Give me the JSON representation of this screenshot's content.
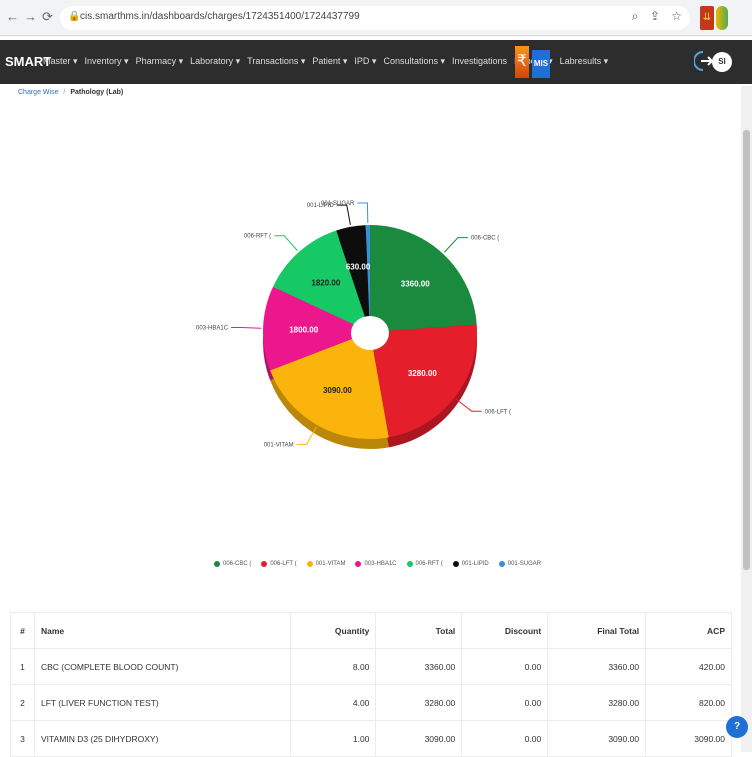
{
  "browser": {
    "url": "cis.smarthms.in/dashboards/charges/1724351400/1724437799",
    "back_icon": "arrow-left-icon",
    "forward_icon": "arrow-right-icon",
    "reload_icon": "reload-icon"
  },
  "nav": {
    "brand": "SMART",
    "menu": [
      "Master ▾",
      "Inventory ▾",
      "Pharmacy ▾",
      "Laboratory ▾",
      "Transactions ▾",
      "Patient ▾",
      "IPD ▾",
      "Consultations ▾",
      "Investigations",
      "Reports ▾",
      "Labresults ▾"
    ],
    "mis": "MIS",
    "avatar": "SI"
  },
  "breadcrumb": {
    "parent": "Charge Wise",
    "current": "Pathology (Lab)"
  },
  "chart_data": {
    "type": "pie",
    "title": "",
    "slices": [
      {
        "label": "006-CBC (",
        "value": 3360.0,
        "value_label": "3360.00",
        "color": "#1a8a3e"
      },
      {
        "label": "006-LFT (",
        "value": 3280.0,
        "value_label": "3280.00",
        "color": "#e41e2b"
      },
      {
        "label": "001-VITAM",
        "value": 3090.0,
        "value_label": "3090.00",
        "color": "#fbb40c"
      },
      {
        "label": "003-HBA1C",
        "value": 1800.0,
        "value_label": "1800.00",
        "color": "#ec178c"
      },
      {
        "label": "006-RFT (",
        "value": 1820.0,
        "value_label": "1820.00",
        "color": "#17c964"
      },
      {
        "label": "001-LIPID",
        "value": 630.0,
        "value_label": "630.00",
        "color": "#0d0d0d"
      },
      {
        "label": "001-SUGAR",
        "value": 90.0,
        "value_label": "",
        "color": "#3b8fd9"
      }
    ],
    "legend": [
      "006-CBC (",
      "006-LFT (",
      "001-VITAM",
      "003-HBA1C",
      "006-RFT (",
      "001-LIPID",
      "001-SUGAR"
    ],
    "legend_position": "bottom"
  },
  "table": {
    "headers": [
      "#",
      "Name",
      "Quantity",
      "Total",
      "Discount",
      "Final Total",
      "ACP"
    ],
    "rows": [
      [
        "1",
        "CBC (COMPLETE BLOOD COUNT)",
        "8.00",
        "3360.00",
        "0.00",
        "3360.00",
        "420.00"
      ],
      [
        "2",
        "LFT (LIVER FUNCTION TEST)",
        "4.00",
        "3280.00",
        "0.00",
        "3280.00",
        "820.00"
      ],
      [
        "3",
        "VITAMIN D3 (25 DIHYDROXY)",
        "1.00",
        "3090.00",
        "0.00",
        "3090.00",
        "3090.00"
      ]
    ]
  },
  "help_label": "?"
}
